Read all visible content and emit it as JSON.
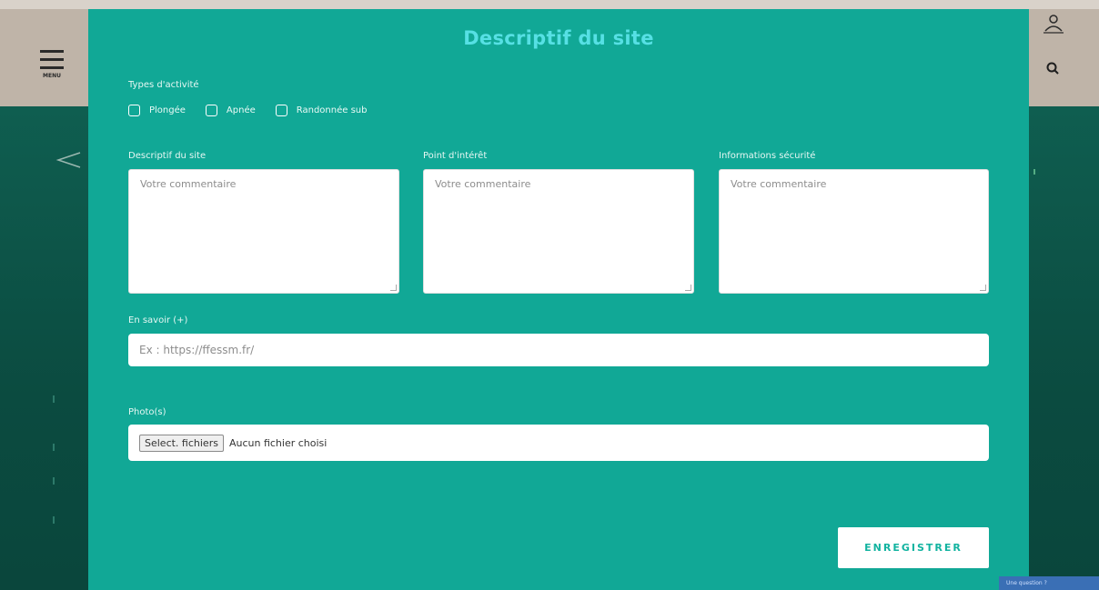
{
  "header": {
    "menu_label": "MENU"
  },
  "modal": {
    "title": "Descriptif du site",
    "activity_types_label": "Types d'activité",
    "activities": [
      {
        "label": "Plongée",
        "checked": false
      },
      {
        "label": "Apnée",
        "checked": false
      },
      {
        "label": "Randonnée sub",
        "checked": false
      }
    ],
    "description_label": "Descriptif du site",
    "description_placeholder": "Votre commentaire",
    "interest_label": "Point d'intérêt",
    "interest_placeholder": "Votre commentaire",
    "safety_label": "Informations sécurité",
    "safety_placeholder": "Votre commentaire",
    "link_label": "En savoir (+)",
    "link_placeholder": "Ex : https://ffessm.fr/",
    "photos_label": "Photo(s)",
    "file_button": "Select. fichiers",
    "file_status": "Aucun fichier choisi",
    "save_button": "ENREGISTRER"
  },
  "corner_tag": "Une question ?",
  "colors": {
    "modal_bg": "#11a896",
    "title": "#56e0e4",
    "accent_text": "#12b3a0"
  }
}
